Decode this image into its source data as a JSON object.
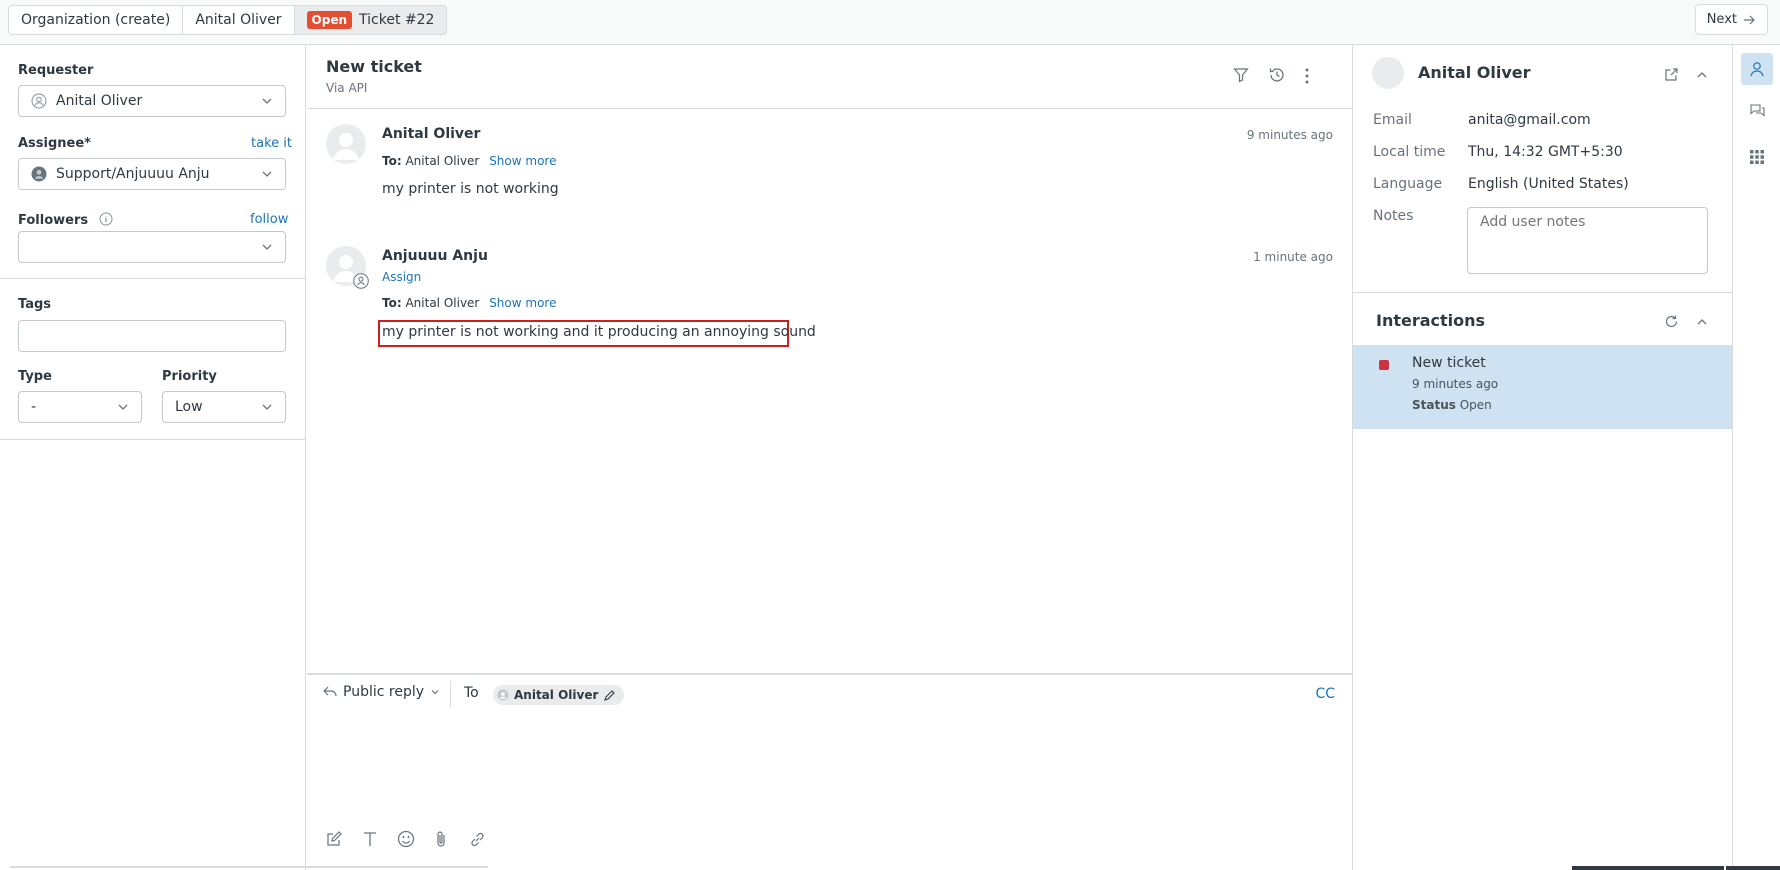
{
  "tabs": {
    "org": "Organization (create)",
    "user": "Anital Oliver",
    "ticket_status": "Open",
    "ticket": "Ticket #22"
  },
  "next_label": "Next",
  "left": {
    "requester_label": "Requester",
    "requester_value": "Anital Oliver",
    "assignee_label": "Assignee*",
    "take_it": "take it",
    "assignee_value": "Support/Anjuuuu Anju",
    "followers_label": "Followers",
    "follow": "follow",
    "tags_label": "Tags",
    "type_label": "Type",
    "type_value": "-",
    "priority_label": "Priority",
    "priority_value": "Low"
  },
  "conversation": {
    "title": "New ticket",
    "subtitle": "Via API",
    "messages": [
      {
        "author": "Anital Oliver",
        "time": "9 minutes ago",
        "to_label": "To:",
        "to_value": "Anital Oliver",
        "show_more": "Show more",
        "body": "my printer is not working"
      },
      {
        "author": "Anjuuuu Anju",
        "assign": "Assign",
        "time": "1 minute ago",
        "to_label": "To:",
        "to_value": "Anital Oliver",
        "show_more": "Show more",
        "body": "my printer is not working and it producing an annoying sound"
      }
    ]
  },
  "composer": {
    "mode": "Public reply",
    "to_label": "To",
    "recipient": "Anital Oliver",
    "cc": "CC"
  },
  "user_panel": {
    "name": "Anital Oliver",
    "email_label": "Email",
    "email": "anita@gmail.com",
    "localtime_label": "Local time",
    "localtime": "Thu, 14:32 GMT+5:30",
    "language_label": "Language",
    "language": "English (United States)",
    "notes_label": "Notes",
    "notes_placeholder": "Add user notes"
  },
  "interactions": {
    "title": "Interactions",
    "items": [
      {
        "title": "New ticket",
        "time": "9 minutes ago",
        "status_label": "Status",
        "status": "Open"
      }
    ]
  },
  "colors": {
    "accent": "#1f73b7",
    "open_badge": "#e34f32",
    "highlight_box": "#cc1f1f",
    "interaction_bg": "#cfe2f2"
  }
}
